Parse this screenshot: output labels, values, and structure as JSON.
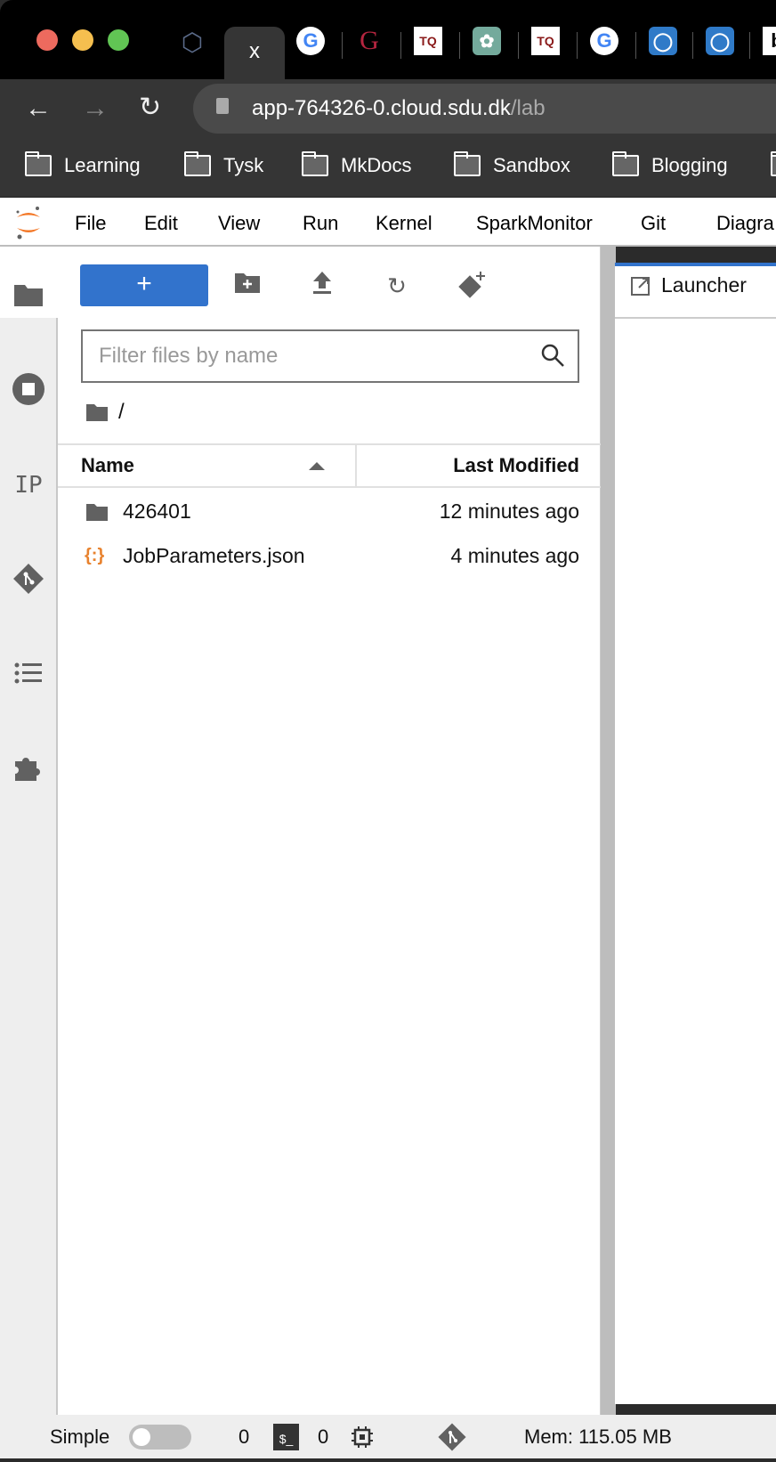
{
  "browser": {
    "tabs": [
      {
        "icon": "polyhedron-icon"
      },
      {
        "icon": "close-icon",
        "label": "x",
        "active": true
      },
      {
        "icon": "google-icon",
        "label": "G"
      },
      {
        "icon": "g-serif-icon",
        "label": "G"
      },
      {
        "icon": "tq-icon",
        "label": "TQ"
      },
      {
        "icon": "chatgpt-icon"
      },
      {
        "icon": "tq-icon",
        "label": "TQ"
      },
      {
        "icon": "google-icon",
        "label": "G"
      },
      {
        "icon": "cloud-icon"
      },
      {
        "icon": "cloud-icon"
      },
      {
        "icon": "b-icon",
        "label": "b"
      }
    ],
    "url_host": "app-764326-0.cloud.sdu.dk",
    "url_path": "/lab",
    "bookmarks": [
      "Learning",
      "Tysk",
      "MkDocs",
      "Sandbox",
      "Blogging"
    ]
  },
  "menu": [
    "File",
    "Edit",
    "View",
    "Run",
    "Kernel",
    "SparkMonitor",
    "Git",
    "Diagra"
  ],
  "sidebar": {
    "ip_label": "IP",
    "icons": [
      "folder-icon",
      "stop-circle-icon",
      "ip-icon",
      "git-icon",
      "list-icon",
      "puzzle-icon"
    ]
  },
  "filebrowser": {
    "new_label": "+",
    "filter_placeholder": "Filter files by name",
    "breadcrumb": "/",
    "columns": {
      "name": "Name",
      "modified": "Last Modified"
    },
    "rows": [
      {
        "name": "426401",
        "modified": "12 minutes ago",
        "type": "folder"
      },
      {
        "name": "JobParameters.json",
        "modified": "4 minutes ago",
        "type": "json"
      }
    ]
  },
  "launcher": {
    "tab_label": "Launcher"
  },
  "status": {
    "mode_label": "Simple",
    "mode_on": false,
    "terminals": "0",
    "terminal_icon": "$_",
    "kernels": "0",
    "memory": "Mem: 115.05 MB"
  },
  "colors": {
    "accent": "#3273cc",
    "json_icon": "#e8822e",
    "jupyter_orange": "#f37726"
  }
}
